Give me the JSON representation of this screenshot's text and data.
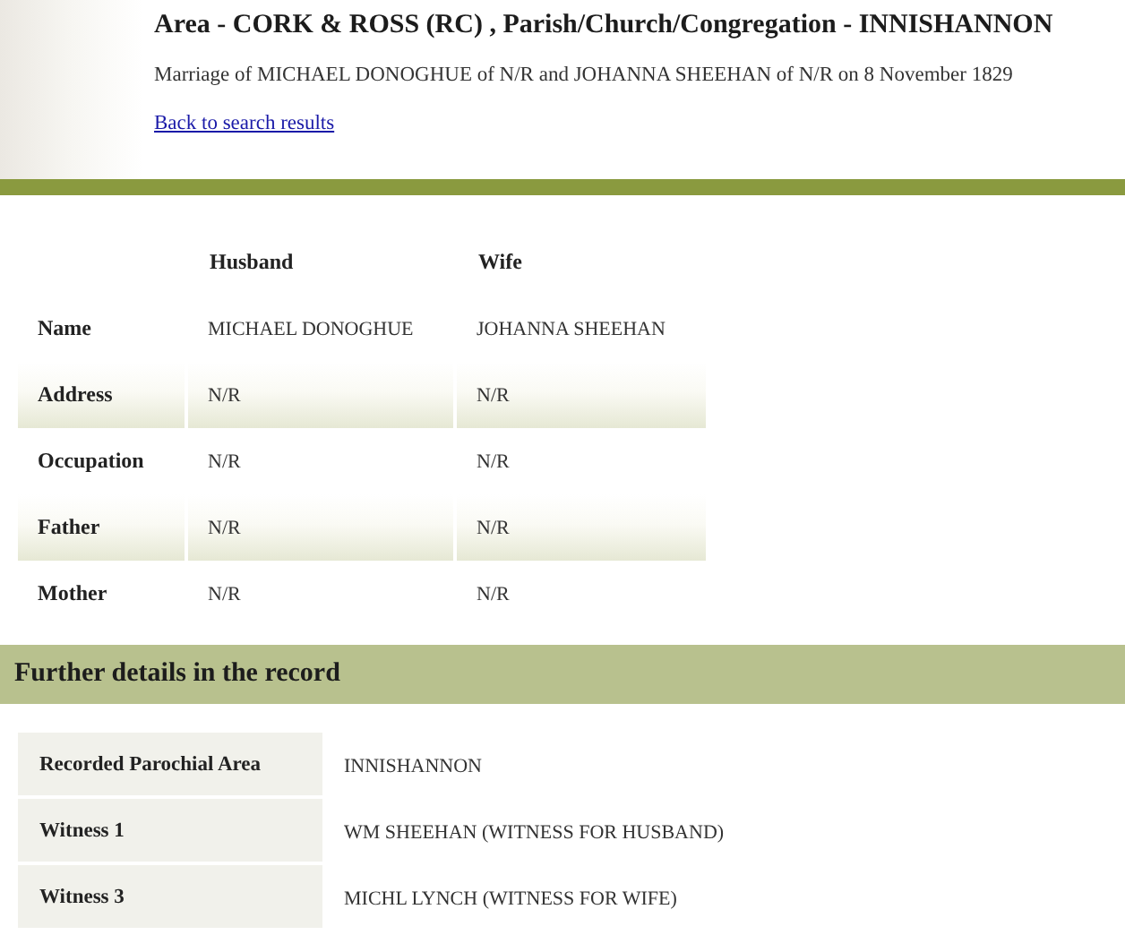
{
  "header": {
    "title": "Area - CORK & ROSS (RC) , Parish/Church/Congregation - INNISHANNON",
    "summary": "Marriage of MICHAEL DONOGHUE of N/R and JOHANNA SHEEHAN of N/R on 8 November 1829",
    "back_link": "Back to search results"
  },
  "parties_table": {
    "columns": [
      "Husband",
      "Wife"
    ],
    "rows": [
      {
        "label": "Name",
        "values": [
          "MICHAEL DONOGHUE",
          "JOHANNA SHEEHAN"
        ]
      },
      {
        "label": "Address",
        "values": [
          "N/R",
          "N/R"
        ]
      },
      {
        "label": "Occupation",
        "values": [
          "N/R",
          "N/R"
        ]
      },
      {
        "label": "Father",
        "values": [
          "N/R",
          "N/R"
        ]
      },
      {
        "label": "Mother",
        "values": [
          "N/R",
          "N/R"
        ]
      }
    ]
  },
  "further_details": {
    "heading": "Further details in the record",
    "rows": [
      {
        "label": "Recorded Parochial Area",
        "value": "INNISHANNON"
      },
      {
        "label": "Witness 1",
        "value": "WM SHEEHAN (WITNESS FOR HUSBAND)"
      },
      {
        "label": "Witness 3",
        "value": "MICHL LYNCH (WITNESS FOR WIFE)"
      }
    ]
  }
}
